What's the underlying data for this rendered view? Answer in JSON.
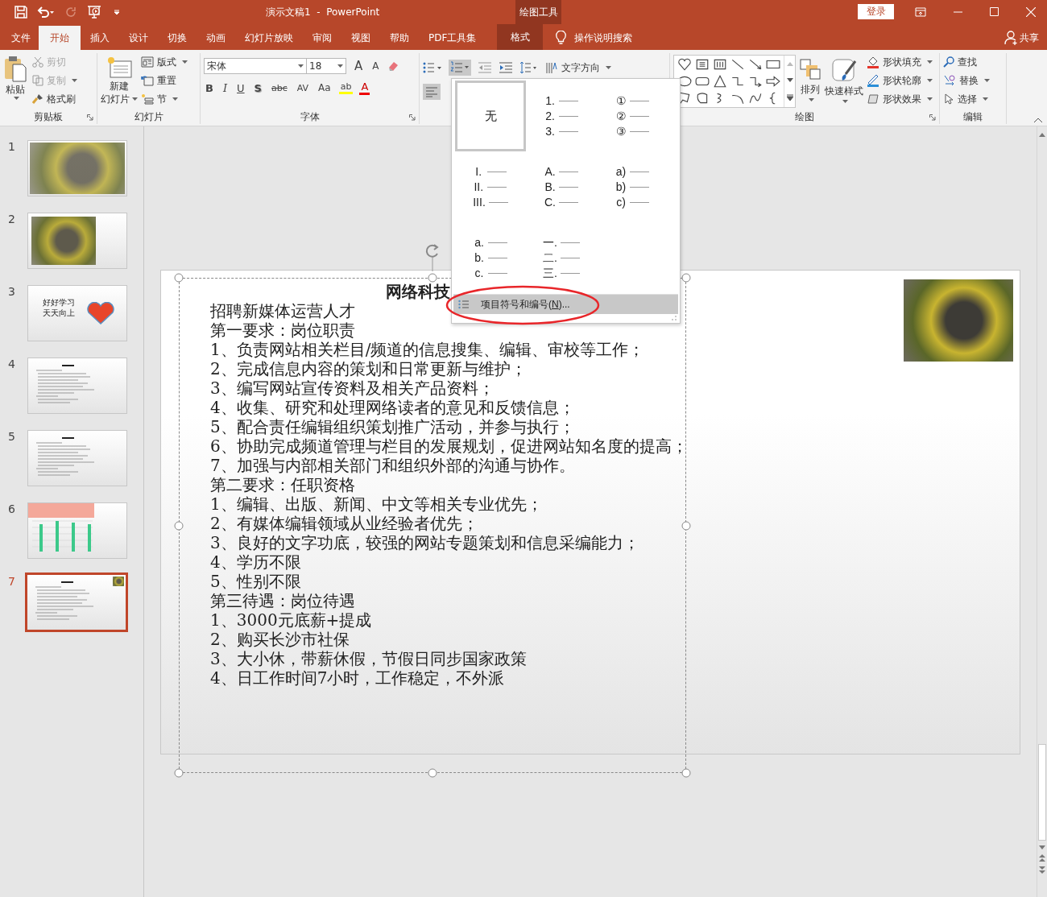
{
  "title_bar": {
    "title": "演示文稿1  -  PowerPoint",
    "contextual_label": "绘图工具",
    "sign_in": "登录"
  },
  "tabs": [
    {
      "label": "文件",
      "selected": false,
      "kind": "file"
    },
    {
      "label": "开始",
      "selected": true,
      "kind": "normal"
    },
    {
      "label": "插入",
      "selected": false,
      "kind": "normal"
    },
    {
      "label": "设计",
      "selected": false,
      "kind": "normal"
    },
    {
      "label": "切换",
      "selected": false,
      "kind": "normal"
    },
    {
      "label": "动画",
      "selected": false,
      "kind": "normal"
    },
    {
      "label": "幻灯片放映",
      "selected": false,
      "kind": "normal"
    },
    {
      "label": "审阅",
      "selected": false,
      "kind": "normal"
    },
    {
      "label": "视图",
      "selected": false,
      "kind": "normal"
    },
    {
      "label": "帮助",
      "selected": false,
      "kind": "normal"
    },
    {
      "label": "PDF工具集",
      "selected": false,
      "kind": "normal"
    },
    {
      "label": "格式",
      "selected": false,
      "kind": "contextual"
    }
  ],
  "tell_me": "操作说明搜索",
  "share": "共享",
  "ribbon": {
    "clipboard": {
      "label": "剪贴板",
      "paste": "粘贴",
      "cut": {
        "label": "剪切",
        "disabled": true
      },
      "copy": {
        "label": "复制",
        "disabled": true
      },
      "format_painter": "格式刷"
    },
    "slides": {
      "label": "幻灯片",
      "new_slide": [
        "新建",
        "幻灯片"
      ],
      "layout": "版式",
      "reset": "重置",
      "section": "节"
    },
    "font": {
      "label": "字体",
      "font_name": "宋体",
      "font_size": "18",
      "grow": "A",
      "shrink": "A",
      "format_buttons": [
        {
          "label": "B",
          "kind": "bold"
        },
        {
          "label": "I",
          "kind": "italic"
        },
        {
          "label": "U",
          "kind": "underline"
        },
        {
          "label": "S",
          "kind": "shadow"
        },
        {
          "label": "abc",
          "kind": "strike"
        },
        {
          "label": "AV",
          "kind": "spacing"
        },
        {
          "label": "Aa",
          "kind": "case"
        }
      ],
      "highlight": "ab",
      "font_color": "A"
    },
    "paragraph": {
      "text_direction": "文字方向"
    },
    "drawing": {
      "label": "绘图",
      "arrange": "排列",
      "quick_styles": "快速样式",
      "shape_fill": "形状填充",
      "shape_outline": "形状轮廓",
      "shape_effects": "形状效果"
    },
    "editing": {
      "label": "编辑",
      "find": "查找",
      "replace": "替换",
      "select": "选择"
    }
  },
  "numbering_menu": {
    "options": [
      {
        "kind": "none",
        "label": "无",
        "selected": true
      },
      {
        "kind": "list",
        "markers": [
          "1.",
          "2.",
          "3."
        ],
        "selected": false
      },
      {
        "kind": "list",
        "markers": [
          "①",
          "②",
          "③"
        ],
        "selected": false
      },
      {
        "kind": "list",
        "markers": [
          "I.",
          "II.",
          "III."
        ],
        "selected": false
      },
      {
        "kind": "list",
        "markers": [
          "A.",
          "B.",
          "C."
        ],
        "selected": false
      },
      {
        "kind": "list",
        "markers": [
          "a)",
          "b)",
          "c)"
        ],
        "selected": false
      },
      {
        "kind": "list",
        "markers": [
          "a.",
          "b.",
          "c."
        ],
        "selected": false
      },
      {
        "kind": "list",
        "markers": [
          "一.",
          "二.",
          "三."
        ],
        "selected": false
      }
    ],
    "command": {
      "before": "项目符号和编号(",
      "key": "N",
      "after": ")...",
      "highlighted": true
    }
  },
  "thumbnails": [
    {
      "number": "1",
      "kind": "photo",
      "selected": false
    },
    {
      "number": "2",
      "kind": "photo-left",
      "selected": false
    },
    {
      "number": "3",
      "kind": "text-heart",
      "lines": [
        "好好学习",
        "天天向上"
      ],
      "selected": false
    },
    {
      "number": "4",
      "kind": "text",
      "selected": false
    },
    {
      "number": "5",
      "kind": "text",
      "selected": false
    },
    {
      "number": "6",
      "kind": "chart",
      "selected": false
    },
    {
      "number": "7",
      "kind": "text-photo",
      "selected": true
    }
  ],
  "slide": {
    "title": "网络科技",
    "lines": [
      "招聘新媒体运营人才",
      "第一要求：岗位职责",
      "1、负责网站相关栏目/频道的信息搜集、编辑、审校等工作；",
      "2、完成信息内容的策划和日常更新与维护；",
      "3、编写网站宣传资料及相关产品资料；",
      "4、收集、研究和处理网络读者的意见和反馈信息；",
      "5、配合责任编辑组织策划推广活动，并参与执行；",
      "6、协助完成频道管理与栏目的发展规划，促进网站知名度的提高；",
      "7、加强与内部相关部门和组织外部的沟通与协作。",
      "第二要求：任职资格",
      "1、编辑、出版、新闻、中文等相关专业优先；",
      "2、有媒体编辑领域从业经验者优先；",
      "3、良好的文字功底，较强的网站专题策划和信息采编能力；",
      "4、学历不限",
      "5、性别不限",
      "第三待遇：岗位待遇",
      "1、3000元底薪+提成",
      "2、购买长沙市社保",
      "3、大小休，带薪休假，节假日同步国家政策",
      "4、日工作时间7小时，工作稳定，不外派"
    ]
  }
}
